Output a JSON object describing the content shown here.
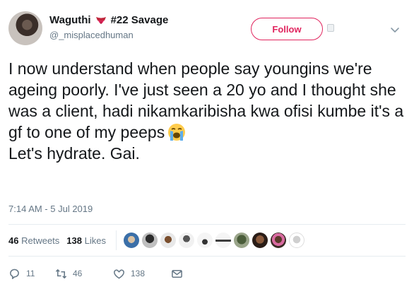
{
  "author": {
    "display_name": "Waguthi",
    "name_suffix": "#22 Savage",
    "handle": "@_misplacedhuman",
    "name_emoji": "tongue-emoji"
  },
  "follow_button": {
    "label": "Follow"
  },
  "tweet": {
    "text": "I now understand when people say youngins we're ageing poorly. I've just seen a 20 yo and I thought she was a client, hadi nikamkaribisha kwa ofisi kumbe it's a gf to one of my peeps",
    "text_after": "Let's hydrate. Gai.",
    "emoji": "loudly-crying-face-emoji",
    "timestamp": "7:14 AM - 5 Jul 2019"
  },
  "stats": {
    "retweets_count": "46",
    "retweets_label": "Retweets",
    "likes_count": "138",
    "likes_label": "Likes"
  },
  "actions": {
    "replies": "11",
    "retweets": "46",
    "likes": "138"
  },
  "colors": {
    "accent": "#e0245e",
    "muted": "#657786",
    "text": "#14171a",
    "divider": "#e6ecf0"
  }
}
